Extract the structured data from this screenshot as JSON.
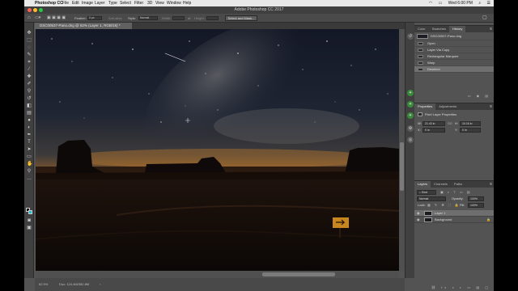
{
  "menubar": {
    "app_name": "Photoshop CC",
    "items": [
      "File",
      "Edit",
      "Image",
      "Layer",
      "Type",
      "Select",
      "Filter",
      "3D",
      "View",
      "Window",
      "Help"
    ],
    "clock": "Wed 6:00 PM"
  },
  "window": {
    "title": "Adobe Photoshop CC 2017"
  },
  "options_bar": {
    "feather_label": "Feather:",
    "feather_value": "0 px",
    "antialias_label": "Anti-alias",
    "style_label": "Style:",
    "style_value": "Normal",
    "width_label": "Width:",
    "height_label": "Height:",
    "select_mask_label": "Select and Mask..."
  },
  "document": {
    "tab_label": "DSC00537-Pano.dng @ 62% (Layer 1, RGB/16) *",
    "zoom": "62.5%",
    "doc_size": "Doc: 124.4M/382.8M"
  },
  "history_panel": {
    "tabs": [
      "Color",
      "Swatches",
      "History"
    ],
    "active_tab": "History",
    "snapshot": "DSC00537-Pano.dng",
    "states": [
      "Open",
      "Layer Via Copy",
      "Rectangular Marquee",
      "Warp",
      "Deselect"
    ],
    "selected_state": "Deselect"
  },
  "properties_panel": {
    "tabs": [
      "Properties",
      "Adjustments"
    ],
    "active_tab": "Properties",
    "header": "Pixel Layer Properties",
    "w_label": "W:",
    "w_value": "21.43 in",
    "h_label": "H:",
    "h_value": "10.16 in",
    "x_label": "X:",
    "x_value": "0 in",
    "y_label": "Y:",
    "y_value": "0 in",
    "link_glyph": "GO"
  },
  "layers_panel": {
    "tabs": [
      "Layers",
      "Channels",
      "Paths"
    ],
    "active_tab": "Layers",
    "kind_label": "Kind",
    "blend_mode": "Normal",
    "opacity_label": "Opacity:",
    "opacity_value": "100%",
    "lock_label": "Lock:",
    "fill_label": "Fill:",
    "fill_value": "100%",
    "layers": [
      {
        "name": "Layer 1",
        "selected": true
      },
      {
        "name": "Background",
        "selected": false
      }
    ]
  },
  "colors": {
    "chrome_dark": "#404040",
    "panel": "#535353",
    "accent_bg_swatch": "#19c4d8",
    "sky_glow": "#d98a2a"
  }
}
